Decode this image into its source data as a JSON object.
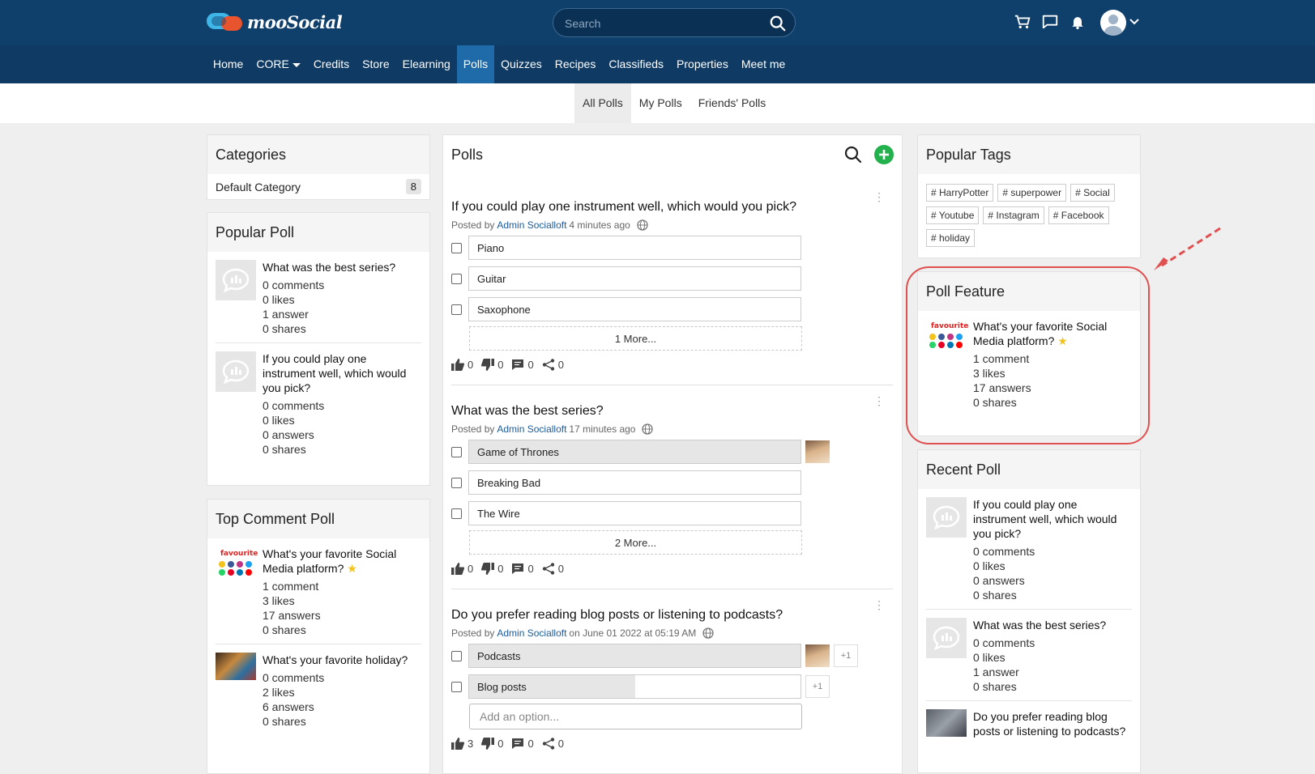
{
  "header": {
    "logo_text": "mooSocial",
    "search_placeholder": "Search",
    "icons": [
      "cart-icon",
      "chat-icon",
      "bell-icon",
      "avatar",
      "chevron-down-icon"
    ]
  },
  "nav": {
    "items": [
      "Home",
      "CORE",
      "Credits",
      "Store",
      "Elearning",
      "Polls",
      "Quizzes",
      "Recipes",
      "Classifieds",
      "Properties",
      "Meet me"
    ],
    "active": "Polls"
  },
  "subnav": {
    "items": [
      "All Polls",
      "My Polls",
      "Friends' Polls"
    ],
    "active": "All Polls"
  },
  "categories": {
    "title": "Categories",
    "items": [
      {
        "label": "Default Category",
        "count": "8"
      }
    ]
  },
  "popular_poll": {
    "title": "Popular Poll",
    "items": [
      {
        "title": "What was the best series?",
        "comments": "0 comments",
        "likes": "0 likes",
        "answers": "1 answer",
        "shares": "0 shares"
      },
      {
        "title": "If you could play one instrument well, which would you pick?",
        "comments": "0 comments",
        "likes": "0 likes",
        "answers": "0 answers",
        "shares": "0 shares"
      }
    ]
  },
  "top_comment_poll": {
    "title": "Top Comment Poll",
    "items": [
      {
        "title": "What's your favorite Social Media platform?",
        "comments": "1 comment",
        "likes": "3 likes",
        "answers": "17 answers",
        "shares": "0 shares"
      },
      {
        "title": "What's your favorite holiday?",
        "comments": "0 comments",
        "likes": "2 likes",
        "answers": "6 answers",
        "shares": "0 shares"
      }
    ]
  },
  "polls": {
    "title": "Polls",
    "items": [
      {
        "title": "If you could play one instrument well, which would you pick?",
        "posted_by": "Posted by",
        "author": "Admin Socialloft",
        "time": "4 minutes ago",
        "options": [
          {
            "label": "Piano",
            "fill": 0
          },
          {
            "label": "Guitar",
            "fill": 0
          },
          {
            "label": "Saxophone",
            "fill": 0
          }
        ],
        "more": "1 More...",
        "likes": "0",
        "dislikes": "0",
        "comments": "0",
        "shares": "0"
      },
      {
        "title": "What was the best series?",
        "posted_by": "Posted by",
        "author": "Admin Socialloft",
        "time": "17 minutes ago",
        "options": [
          {
            "label": "Game of Thrones",
            "fill": 1
          },
          {
            "label": "Breaking Bad",
            "fill": 0
          },
          {
            "label": "The Wire",
            "fill": 0
          }
        ],
        "more": "2 More...",
        "likes": "0",
        "dislikes": "0",
        "comments": "0",
        "shares": "0"
      },
      {
        "title": "Do you prefer reading blog posts or listening to podcasts?",
        "posted_by": "Posted by",
        "author": "Admin Socialloft",
        "time": "on June 01 2022 at 05:19 AM",
        "options": [
          {
            "label": "Podcasts",
            "fill": 1,
            "extra": "+1"
          },
          {
            "label": "Blog posts",
            "fill": 0.5,
            "extra": "+1"
          }
        ],
        "add_placeholder": "Add an option...",
        "likes": "3",
        "dislikes": "0",
        "comments": "0",
        "shares": "0"
      }
    ]
  },
  "popular_tags": {
    "title": "Popular Tags",
    "tags": [
      "# HarryPotter",
      "# superpower",
      "# Social",
      "# Youtube",
      "# Instagram",
      "# Facebook",
      "# holiday"
    ]
  },
  "poll_feature": {
    "title": "Poll Feature",
    "item": {
      "title": "What's your favorite Social Media platform?",
      "comments": "1 comment",
      "likes": "3 likes",
      "answers": "17 answers",
      "shares": "0 shares"
    }
  },
  "recent_poll": {
    "title": "Recent Poll",
    "items": [
      {
        "title": "If you could play one instrument well, which would you pick?",
        "comments": "0 comments",
        "likes": "0 likes",
        "answers": "0 answers",
        "shares": "0 shares"
      },
      {
        "title": "What was the best series?",
        "comments": "0 comments",
        "likes": "0 likes",
        "answers": "1 answer",
        "shares": "0 shares"
      },
      {
        "title": "Do you prefer reading blog posts or listening to podcasts?"
      }
    ]
  },
  "colors": {
    "topbar": "#0f3f6b",
    "active_nav": "#1f6aa8",
    "link": "#1e5a97",
    "add_button": "#22b14c",
    "annotation": "#e05050",
    "star": "#f3c21b"
  }
}
